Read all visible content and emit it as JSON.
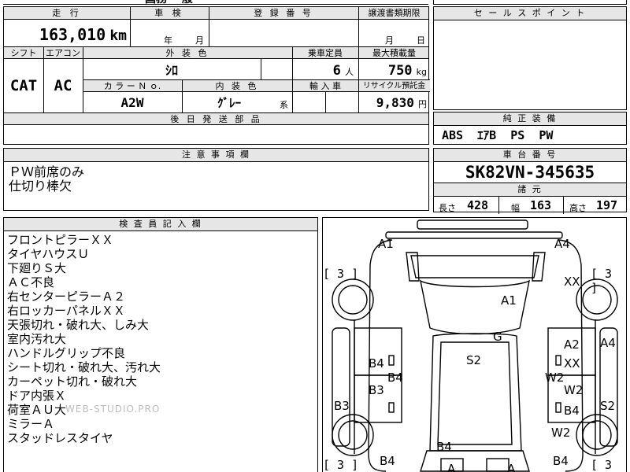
{
  "top_strip": {
    "partial_text": "国務 一般"
  },
  "spec": {
    "mileage_header": "走 行",
    "inspection_header": "車 検",
    "registration_header": "登 録 番 号",
    "transfer_header": "譲渡書類期限",
    "mileage_value": "163,010",
    "mileage_unit": "km",
    "year_label": "年",
    "month_label": "月",
    "transfer_month": "月",
    "transfer_day": "日",
    "shift_header": "シフト",
    "aircon_header": "エアコン",
    "exterior_header": "外 装 色",
    "capacity_header": "乗車定員",
    "max_load_header": "最大積載量",
    "shift_value": "CAT",
    "aircon_value": "AC",
    "exterior_value": "ｼﾛ",
    "capacity_value": "6",
    "capacity_unit": "人",
    "max_load_value": "750",
    "max_load_unit": "kg",
    "color_no_header": "カ ラ ー Ｎ ｏ.",
    "interior_header": "内 装 色",
    "import_header": "輸 入 車",
    "recycle_header": "リサイクル預託金",
    "color_no_value": "A2W",
    "interior_value": "ｸﾞﾚｰ",
    "interior_suffix": "系",
    "recycle_value": "9,830",
    "recycle_unit": "円",
    "later_parts_header": "後 日 発 送 部 品"
  },
  "sales_point": {
    "header": "セ ー ル ス ポ イ ン ト"
  },
  "equipment": {
    "header": "純 正 装 備",
    "value": "ABS  ｴｱB  PS  PW"
  },
  "notes": {
    "header": "注 意 事 項 欄",
    "lines": [
      "ＰＷ前席のみ",
      "仕切り棒欠"
    ]
  },
  "chassis": {
    "header": "車 台 番 号",
    "value": "SK82VN-345635",
    "dims_header": "諸 元",
    "length_label": "長さ",
    "length_value": "428",
    "width_label": "幅",
    "width_value": "163",
    "height_label": "高さ",
    "height_value": "197"
  },
  "inspector": {
    "header": "検 査 員 記 入 欄",
    "lines": [
      "フロントピラーＸＸ",
      "タイヤハウスＵ",
      "下廻りＳ大",
      "ＡＣ不良",
      "右センターピラーＡ２",
      "右ロッカーパネルＸＸ",
      "天張切れ・破れ大、しみ大",
      "室内汚れ大",
      "ハンドルグリップ不良",
      "シート切れ・破れ大、汚れ大",
      "カーペット切れ・破れ大",
      "ドア内張Ｘ",
      "荷室ＡＵ大",
      "ミラーＡ",
      "スタッドレスタイヤ"
    ],
    "watermark": "WEB-STUDIO.PRO"
  },
  "diagram": {
    "tire_bracket": "[ 3 ]",
    "labels": {
      "a1_top": "A1",
      "a4_top": "A4",
      "xx_right": "XX",
      "a1_center": "A1",
      "g": "G",
      "a2": "A2",
      "a4_right": "A4",
      "xx_right2": "XX",
      "b4_left1": "B4",
      "s2_center": "S2",
      "b4_left2": "B4",
      "w2_right1": "W2",
      "w2_right2": "W2",
      "b3_inner": "B3",
      "b3_side": "B3",
      "b4_right": "B4",
      "s2_side": "S2",
      "w2_right3": "W2",
      "b4_bottom": "B4",
      "b4_bottom_left": "B4",
      "b4_bottom_right": "B4",
      "a_bottom_left": "A",
      "a_bottom_right": "A"
    }
  }
}
